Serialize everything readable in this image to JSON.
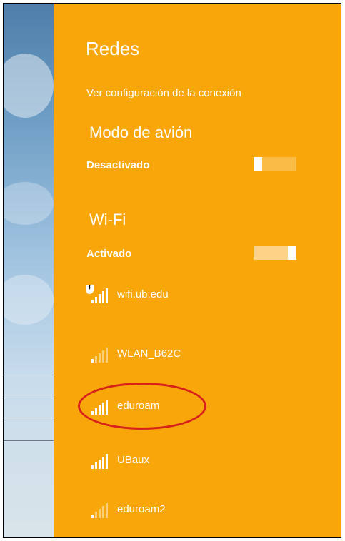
{
  "panel": {
    "title": "Redes",
    "connection_link": "Ver configuración de la conexión"
  },
  "airplane_mode": {
    "label": "Modo de avión",
    "state": "Desactivado",
    "enabled": false
  },
  "wifi": {
    "label": "Wi-Fi",
    "state": "Activado",
    "enabled": true
  },
  "networks": [
    {
      "name": "wifi.ub.edu",
      "signal": "signal-full-icon",
      "secured": false
    },
    {
      "name": "WLAN_B62C",
      "signal": "signal-weak-icon",
      "secured": true
    },
    {
      "name": "eduroam",
      "signal": "signal-full-icon",
      "secured": true
    },
    {
      "name": "UBaux",
      "signal": "signal-full-icon",
      "secured": true
    },
    {
      "name": "eduroam2",
      "signal": "signal-weak-icon",
      "secured": true
    }
  ],
  "colors": {
    "panel_bg": "#f9a60a",
    "highlight_circle": "#d9211c"
  }
}
